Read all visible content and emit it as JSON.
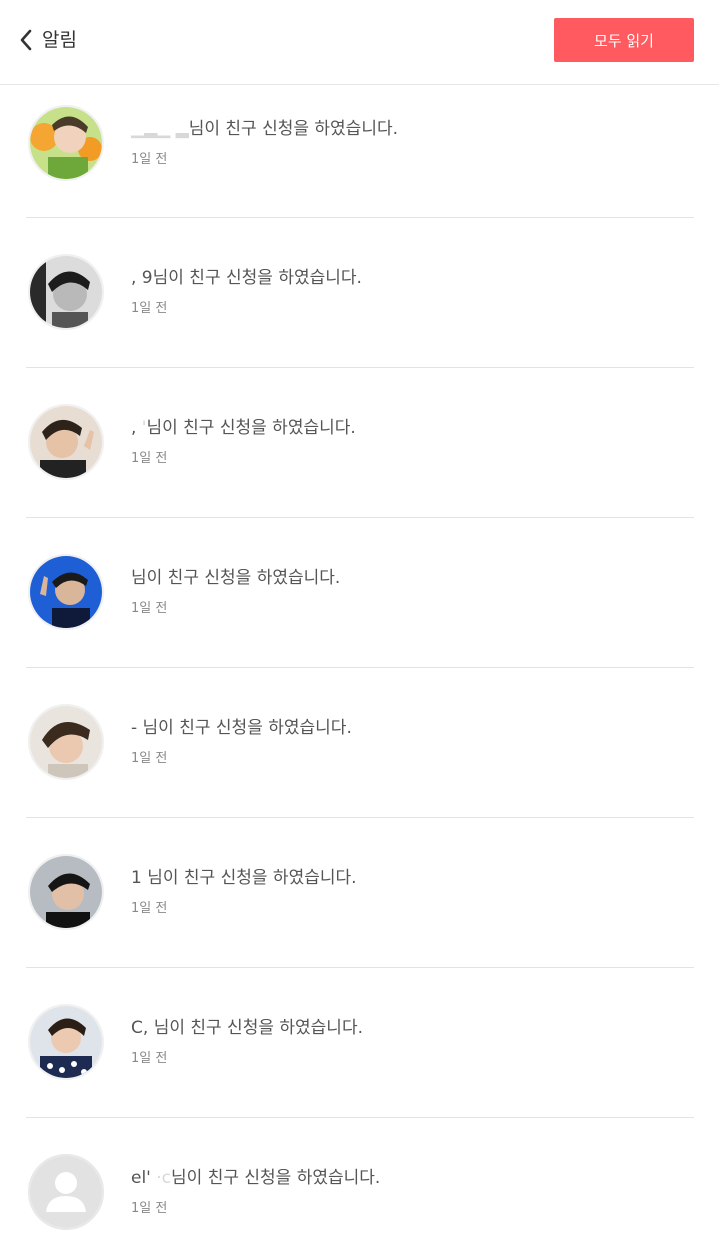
{
  "header": {
    "title": "알림",
    "read_all_label": "모두 읽기"
  },
  "notifications": [
    {
      "name_visible": "",
      "name_masked": "▁▂▁ ▂",
      "message": "님이 친구 신청을 하였습니다.",
      "time": "1일 전",
      "avatar": "photo-oranges"
    },
    {
      "name_visible": ", 9",
      "name_masked": "      ",
      "message": "님이 친구 신청을 하였습니다.",
      "time": "1일 전",
      "avatar": "photo-monochrome"
    },
    {
      "name_visible": ",",
      "name_masked": "      '",
      "message": "님이 친구 신청을 하였습니다.",
      "time": "1일 전",
      "avatar": "photo-v-sign"
    },
    {
      "name_visible": "",
      "name_masked": "           ",
      "message": "님이 친구 신청을 하였습니다.",
      "time": "1일 전",
      "avatar": "photo-blue-bg"
    },
    {
      "name_visible": "-",
      "name_masked": "     ",
      "message": "님이 친구 신청을 하였습니다.",
      "time": "1일 전",
      "avatar": "photo-brown-hair"
    },
    {
      "name_visible": "1",
      "name_masked": "    ",
      "message": "님이 친구 신청을 하였습니다.",
      "time": "1일 전",
      "avatar": "photo-dark"
    },
    {
      "name_visible": "C,",
      "name_masked": "          ",
      "message": "님이 친구 신청을 하였습니다.",
      "time": "1일 전",
      "avatar": "photo-patterned"
    },
    {
      "name_visible": "el'",
      "name_masked": "       ·c",
      "message": "님이 친구 신청을 하였습니다.",
      "time": "1일 전",
      "avatar": "default-user-icon"
    }
  ]
}
